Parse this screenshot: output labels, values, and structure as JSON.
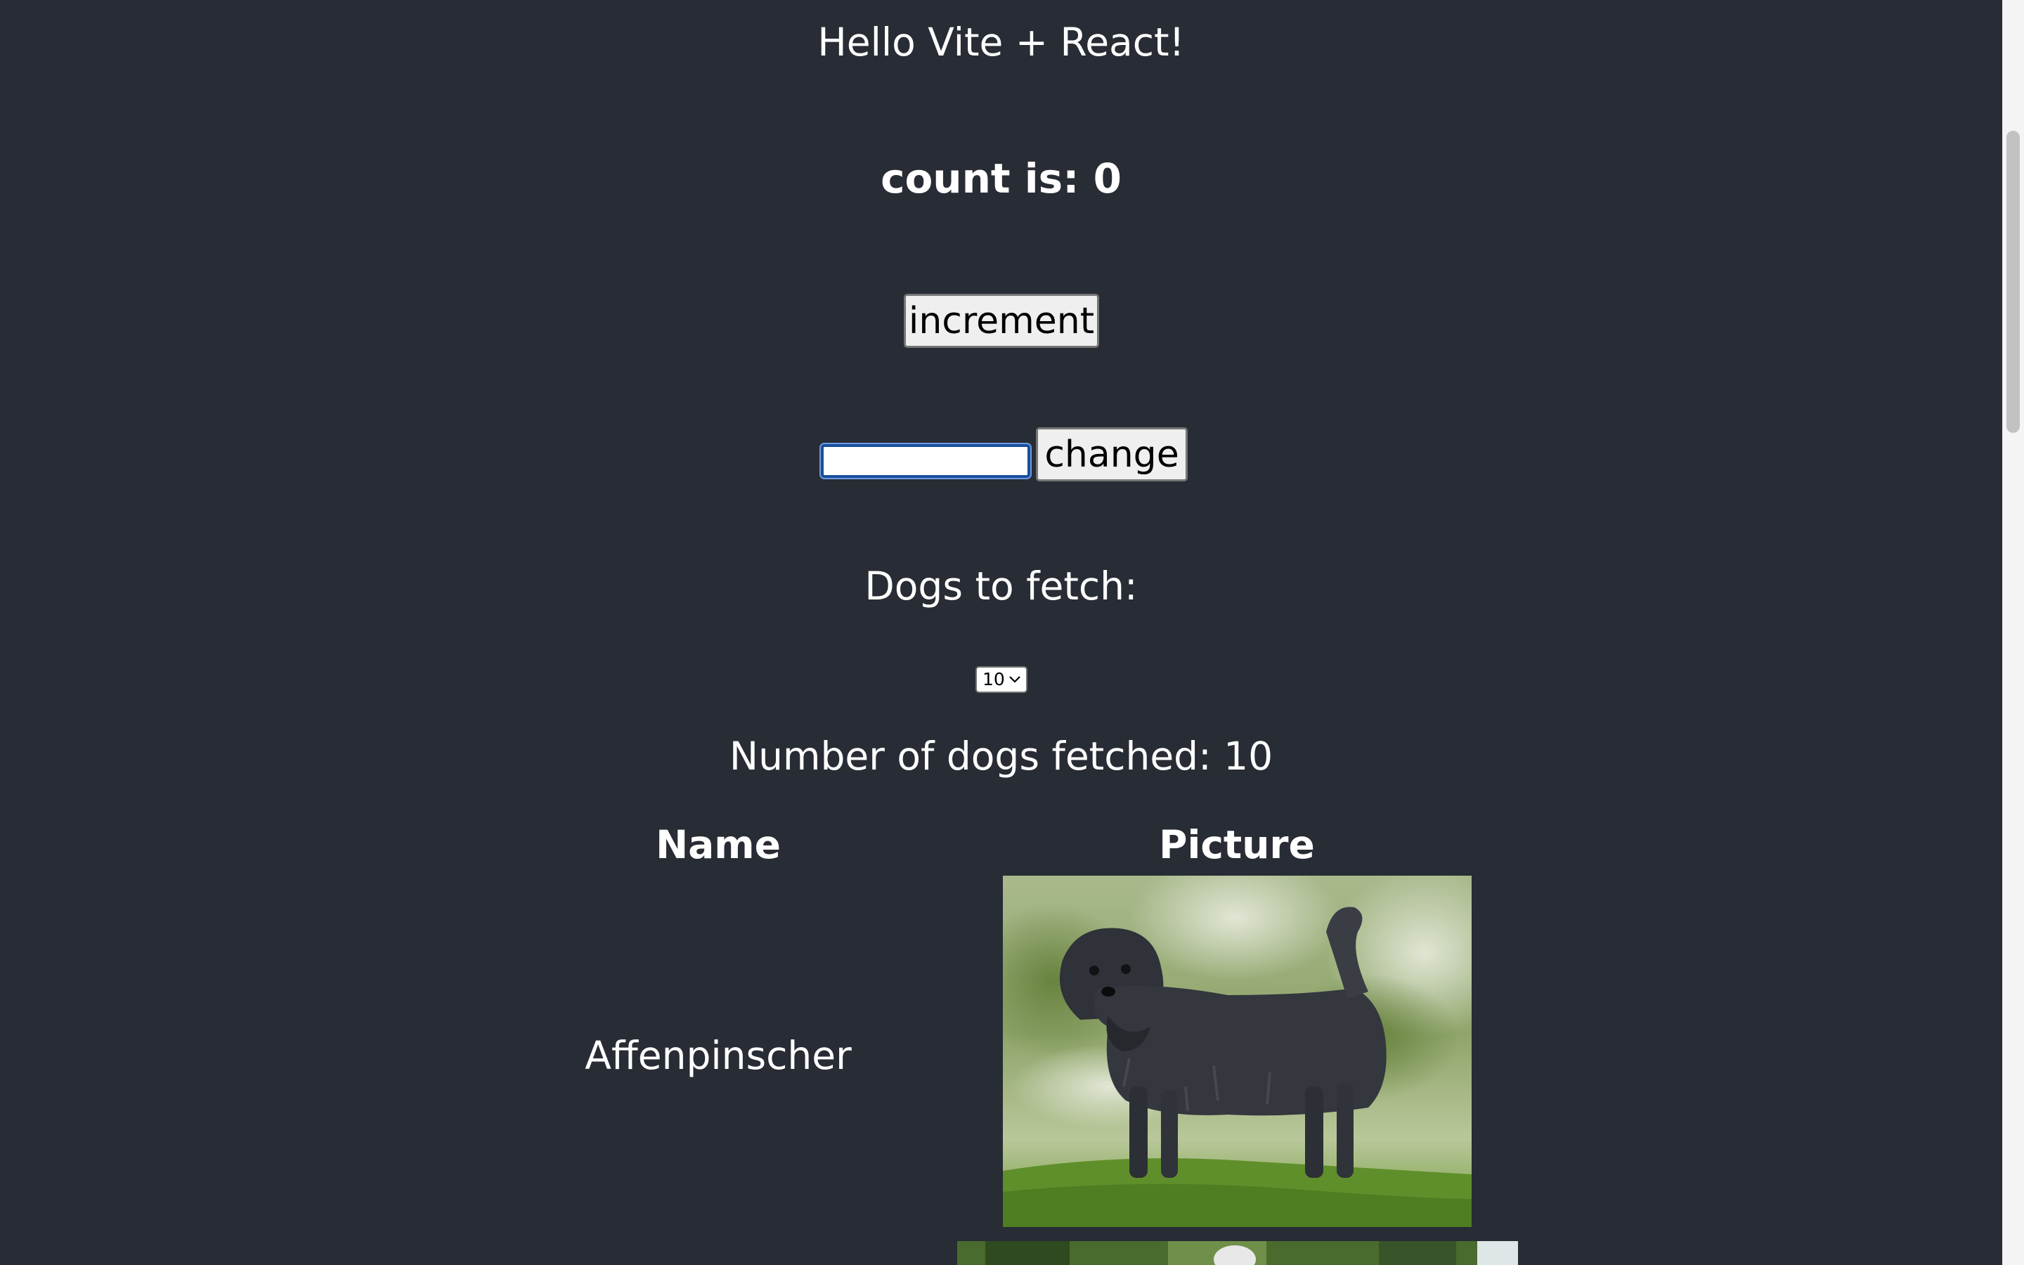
{
  "header": {
    "title": "Hello Vite + React!"
  },
  "counter": {
    "label": "count is: 0",
    "increment_label": "increment"
  },
  "change_form": {
    "input_value": "",
    "button_label": "change"
  },
  "fetch": {
    "label": "Dogs to fetch:",
    "selected_option": "10",
    "fetched_text": "Number of dogs fetched: 10"
  },
  "table": {
    "columns": [
      "Name",
      "Picture"
    ],
    "rows": [
      {
        "name": "Affenpinscher",
        "picture": "dog-photo"
      }
    ]
  },
  "colors": {
    "background": "#282c34",
    "text": "#ffffff",
    "input_focus": "#1a4f9c"
  }
}
